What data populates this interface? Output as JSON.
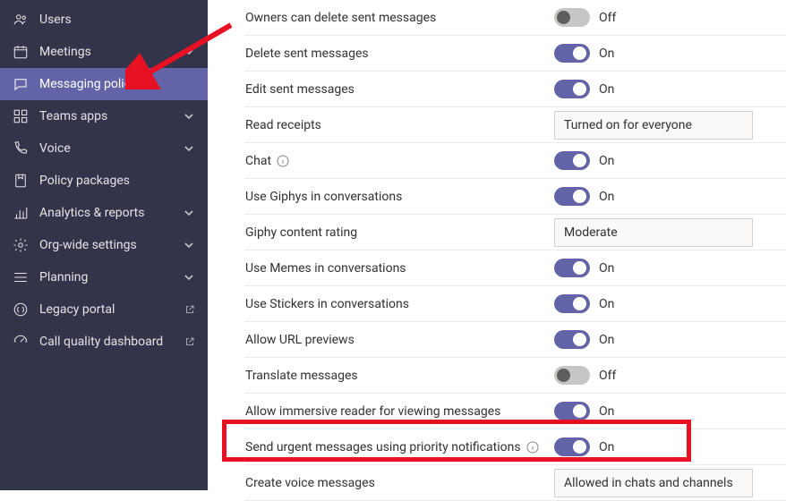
{
  "sidebar": {
    "items": [
      {
        "label": "Users",
        "icon": "users-icon",
        "expandable": false
      },
      {
        "label": "Meetings",
        "icon": "calendar-icon",
        "expandable": true
      },
      {
        "label": "Messaging policies",
        "icon": "message-icon",
        "expandable": false,
        "active": true
      },
      {
        "label": "Teams apps",
        "icon": "apps-icon",
        "expandable": true
      },
      {
        "label": "Voice",
        "icon": "phone-icon",
        "expandable": true
      },
      {
        "label": "Policy packages",
        "icon": "package-icon",
        "expandable": false
      },
      {
        "label": "Analytics & reports",
        "icon": "analytics-icon",
        "expandable": true
      },
      {
        "label": "Org-wide settings",
        "icon": "gear-icon",
        "expandable": true
      },
      {
        "label": "Planning",
        "icon": "planning-icon",
        "expandable": true
      },
      {
        "label": "Legacy portal",
        "icon": "legacy-icon",
        "expandable": false,
        "external": true
      },
      {
        "label": "Call quality dashboard",
        "icon": "dashboard-icon",
        "expandable": false,
        "external": true
      }
    ]
  },
  "settings": [
    {
      "label": "Owners can delete sent messages",
      "type": "toggle",
      "value": "Off"
    },
    {
      "label": "Delete sent messages",
      "type": "toggle",
      "value": "On"
    },
    {
      "label": "Edit sent messages",
      "type": "toggle",
      "value": "On"
    },
    {
      "label": "Read receipts",
      "type": "select",
      "value": "Turned on for everyone"
    },
    {
      "label": "Chat",
      "type": "toggle",
      "value": "On",
      "info": true
    },
    {
      "label": "Use Giphys in conversations",
      "type": "toggle",
      "value": "On"
    },
    {
      "label": "Giphy content rating",
      "type": "select",
      "value": "Moderate"
    },
    {
      "label": "Use Memes in conversations",
      "type": "toggle",
      "value": "On"
    },
    {
      "label": "Use Stickers in conversations",
      "type": "toggle",
      "value": "On"
    },
    {
      "label": "Allow URL previews",
      "type": "toggle",
      "value": "On"
    },
    {
      "label": "Translate messages",
      "type": "toggle",
      "value": "Off"
    },
    {
      "label": "Allow immersive reader for viewing messages",
      "type": "toggle",
      "value": "On"
    },
    {
      "label": "Send urgent messages using priority notifications",
      "type": "toggle",
      "value": "On",
      "info": true,
      "highlighted": true
    },
    {
      "label": "Create voice messages",
      "type": "select",
      "value": "Allowed in chats and channels"
    }
  ]
}
